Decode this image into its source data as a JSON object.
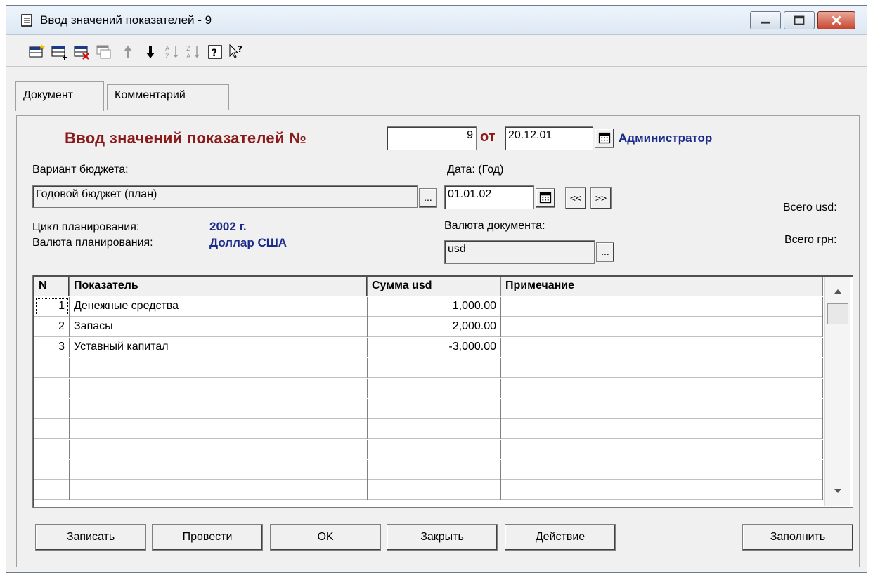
{
  "window": {
    "title": "Ввод значений показателей - 9"
  },
  "tabs": [
    {
      "label": "Документ"
    },
    {
      "label": "Комментарий"
    }
  ],
  "header": {
    "doc_title": "Ввод значений показателей №",
    "number": "9",
    "ot": "от",
    "date": "20.12.01",
    "user": "Администратор"
  },
  "form": {
    "budget_variant_label": "Вариант бюджета:",
    "budget_variant_value": "Годовой бюджет (план)",
    "date_label": "Дата: (Год)",
    "date_value": "01.01.02",
    "prev_btn": "<<",
    "next_btn": ">>",
    "total_usd_label": "Всего usd:",
    "total_grn_label": "Всего грн:",
    "cycle_label": "Цикл планирования:",
    "cycle_value": "2002 г.",
    "plan_currency_label": "Валюта планирования:",
    "plan_currency_value": "Доллар США",
    "doc_currency_label": "Валюта документа:",
    "doc_currency_value": "usd",
    "ellipsis": "..."
  },
  "table": {
    "headers": [
      "N",
      "Показатель",
      "Сумма usd",
      "Примечание"
    ],
    "rows": [
      {
        "n": "1",
        "indicator": "Денежные средства",
        "sum": "1,000.00",
        "note": ""
      },
      {
        "n": "2",
        "indicator": "Запасы",
        "sum": "2,000.00",
        "note": ""
      },
      {
        "n": "3",
        "indicator": "Уставный капитал",
        "sum": "-3,000.00",
        "note": ""
      }
    ]
  },
  "buttons": {
    "save": "Записать",
    "post": "Провести",
    "ok": "OK",
    "close": "Закрыть",
    "action": "Действие",
    "fill": "Заполнить"
  },
  "colors": {
    "title_red": "#8b1a1a",
    "value_blue": "#1a2a8a"
  },
  "icons": [
    "document-icon",
    "new-row-icon",
    "add-row-icon",
    "delete-row-icon",
    "copy-row-icon",
    "move-up-icon",
    "move-down-icon",
    "sort-asc-icon",
    "sort-desc-icon",
    "help-icon",
    "context-help-icon",
    "calendar-icon"
  ]
}
